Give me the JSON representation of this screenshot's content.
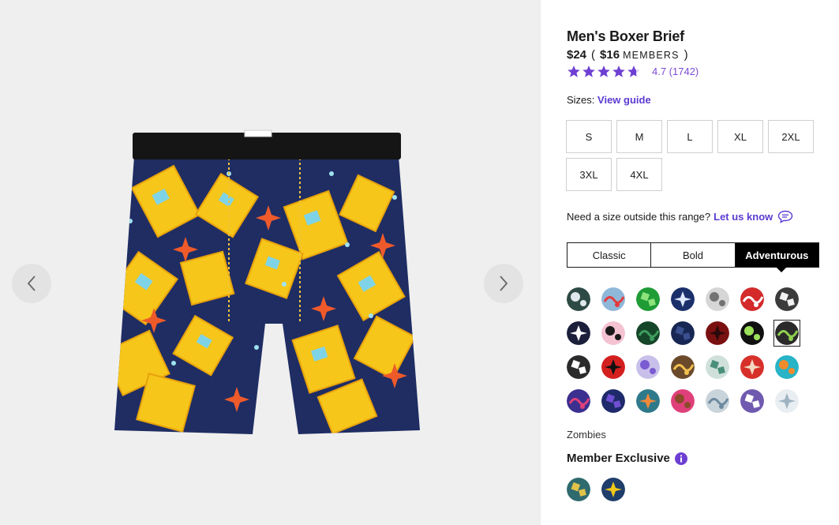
{
  "gallery": {
    "prev_icon": "chevron-left-icon",
    "next_icon": "chevron-right-icon"
  },
  "product": {
    "title": "Men's Boxer Brief",
    "price": "$24",
    "paren_open": "(",
    "member_price": "$16",
    "member_label": "MEMBERS",
    "paren_close": ")",
    "rating": 4.7,
    "rating_text": "4.7  (1742)",
    "star_color": "#6e3fd3"
  },
  "sizes": {
    "label": "Sizes:",
    "guide_link": "View guide",
    "options": [
      "S",
      "M",
      "L",
      "XL",
      "2XL",
      "3XL",
      "4XL"
    ]
  },
  "size_help": {
    "text": "Need a size outside this range?",
    "link": "Let us know",
    "icon": "chat-bubble-icon"
  },
  "style_tabs": {
    "options": [
      "Classic",
      "Bold",
      "Adventurous"
    ],
    "active": "Adventurous"
  },
  "patterns": {
    "selected_name": "Zombies",
    "selected_index": 13,
    "swatch_colors": [
      [
        "#2e4a44",
        "#dfe8ec"
      ],
      [
        "#8fb7d8",
        "#e23b3b"
      ],
      [
        "#1f9c36",
        "#8ee37b"
      ],
      [
        "#1b2f6b",
        "#dfe8ff"
      ],
      [
        "#d6d6d6",
        "#737373"
      ],
      [
        "#d42a2a",
        "#ffffff"
      ],
      [
        "#3b3b3b",
        "#f2f2f2"
      ],
      [
        "#1b1f3a",
        "#ffffff"
      ],
      [
        "#f5c2d2",
        "#1a1a1a"
      ],
      [
        "#16462a",
        "#3e9d5e"
      ],
      [
        "#182654",
        "#3a4f8f"
      ],
      [
        "#7a1010",
        "#2a0a0a"
      ],
      [
        "#111111",
        "#9be15a"
      ],
      [
        "#2a2a2a",
        "#8fd14f"
      ],
      [
        "#2b2b2b",
        "#ffffff"
      ],
      [
        "#d41f1f",
        "#111111"
      ],
      [
        "#c8c0ea",
        "#7a5bd1"
      ],
      [
        "#6b4a2b",
        "#f2c14e"
      ],
      [
        "#cfe0db",
        "#4a8f7a"
      ],
      [
        "#d7302a",
        "#f3d9c2"
      ],
      [
        "#28b3c7",
        "#f28b2b"
      ],
      [
        "#3b2f8f",
        "#e0407a"
      ],
      [
        "#1e2a6b",
        "#6f4fd1"
      ],
      [
        "#2f7a8a",
        "#f08a3a"
      ],
      [
        "#e0407a",
        "#8b4a2b"
      ],
      [
        "#c9d3da",
        "#6b8aa0"
      ],
      [
        "#6f5ab0",
        "#ffffff"
      ],
      [
        "#e8eef2",
        "#9fb3c2"
      ]
    ]
  },
  "member_exclusive": {
    "label": "Member Exclusive",
    "info_icon": "info-icon",
    "info_color": "#6e3fd3",
    "swatch_colors": [
      [
        "#2f6a6e",
        "#e0c24a"
      ],
      [
        "#1f3e6b",
        "#f2c81a"
      ]
    ]
  },
  "colors": {
    "accent": "#5b3bd1",
    "gallery_bg": "#efefef"
  }
}
